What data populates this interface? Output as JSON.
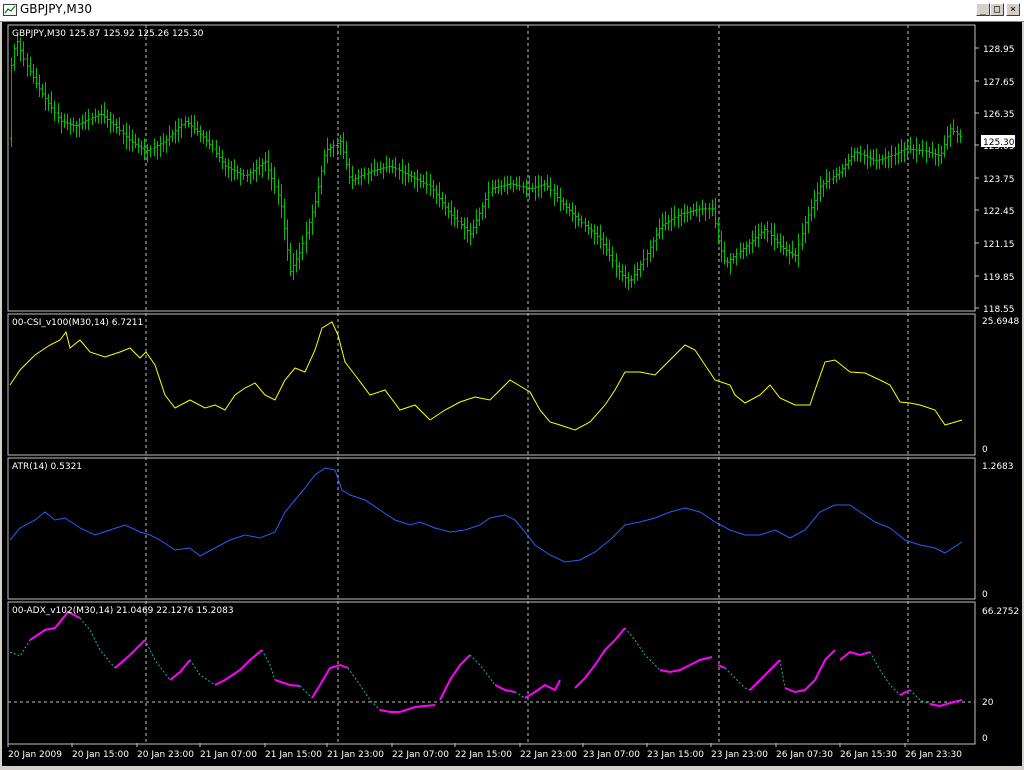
{
  "window": {
    "title": "GBPJPY,M30",
    "buttons": {
      "minimize": "_",
      "maximize": "□",
      "close": "×"
    }
  },
  "colors": {
    "background": "#000000",
    "candle": "#00c000",
    "csi": "#ffff00",
    "atr": "#2060ff",
    "adx_solid": "#ff00ff",
    "adx_dotted": "#20b2aa",
    "grid": "#c0c0c0",
    "text": "#ffffff",
    "price_tag_bg": "#ffffff"
  },
  "panels": {
    "price": {
      "label": "GBPJPY,M30  125.87 125.92 125.26 125.30",
      "axis": [
        "128.95",
        "127.65",
        "126.35",
        "125.05",
        "123.75",
        "122.45",
        "121.15",
        "119.85",
        "118.55"
      ],
      "current_price": "125.30"
    },
    "csi": {
      "label": "00-CSI_v100(M30,14) 6.7211",
      "axis_top": "25.6948",
      "axis_bottom": "0"
    },
    "atr": {
      "label": "ATR(14) 0.5321",
      "axis_top": "1.2683",
      "axis_bottom": "0"
    },
    "adx": {
      "label": "00-ADX_v102(M30,14) 21.0469 22.1276 15.2083",
      "axis_top": "66.2752",
      "axis_mid": "20",
      "axis_bottom": "0"
    }
  },
  "time_axis": [
    "20 Jan 2009",
    "20 Jan 15:00",
    "20 Jan 23:00",
    "21 Jan 07:00",
    "21 Jan 15:00",
    "21 Jan 23:00",
    "22 Jan 07:00",
    "22 Jan 15:00",
    "22 Jan 23:00",
    "23 Jan 07:00",
    "23 Jan 15:00",
    "23 Jan 23:00",
    "26 Jan 07:30",
    "26 Jan 15:30",
    "26 Jan 23:30"
  ]
}
